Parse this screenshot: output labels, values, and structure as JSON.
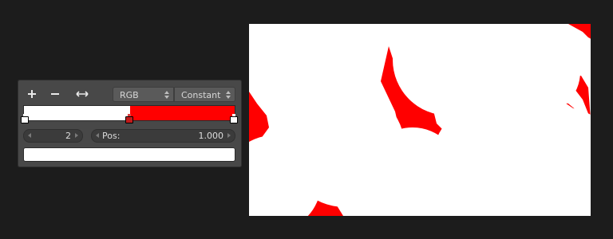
{
  "toolbar": {
    "add_icon": "plus-icon",
    "remove_icon": "minus-icon",
    "flip_icon": "flip-horizontal-icon",
    "color_mode": "RGB",
    "interpolation": "Constant"
  },
  "ramp": {
    "colors": {
      "white": "#ffffff",
      "red": "#ff0000",
      "marker_selected": "#c21a1a"
    },
    "stop_positions": [
      0.0,
      0.5,
      1.0
    ],
    "active_stop": 2
  },
  "active_index": "2",
  "position": {
    "label": "Pos:",
    "value": "1.000"
  },
  "active_color": "#ffffff",
  "preview": {
    "background": "#ffffff",
    "pattern_color": "#ff0000"
  }
}
